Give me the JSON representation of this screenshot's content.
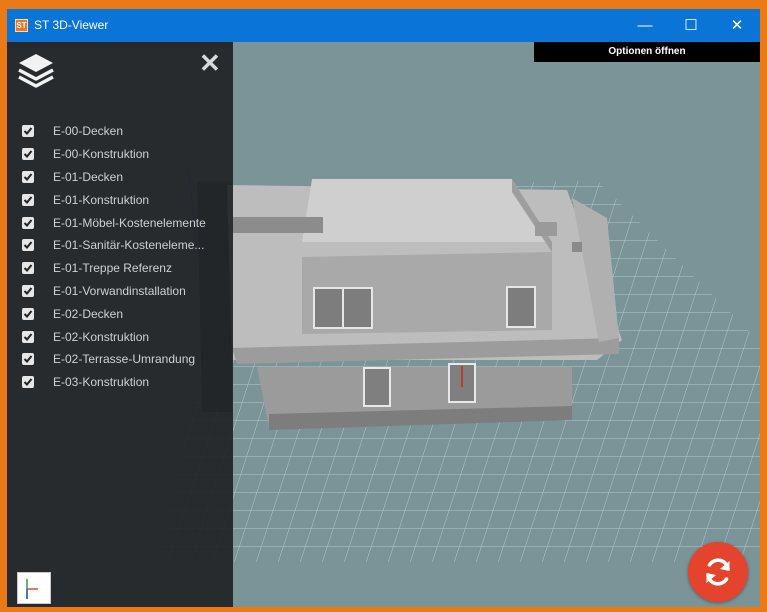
{
  "window": {
    "title": "ST 3D-Viewer",
    "app_icon_text": "ST",
    "minimize_glyph": "—",
    "maximize_glyph": "☐",
    "close_glyph": "✕"
  },
  "toolbar": {
    "options_label": "Optionen öffnen"
  },
  "layer_panel": {
    "close_glyph": "✕",
    "layers": [
      {
        "label": "E-00-Decken",
        "checked": true
      },
      {
        "label": "E-00-Konstruktion",
        "checked": true
      },
      {
        "label": "E-01-Decken",
        "checked": true
      },
      {
        "label": "E-01-Konstruktion",
        "checked": true
      },
      {
        "label": "E-01-Möbel-Kostenelemente",
        "checked": true
      },
      {
        "label": "E-01-Sanitär-Kosteneleme...",
        "checked": true
      },
      {
        "label": "E-01-Treppe Referenz",
        "checked": true
      },
      {
        "label": "E-01-Vorwandinstallation",
        "checked": true
      },
      {
        "label": "E-02-Decken",
        "checked": true
      },
      {
        "label": "E-02-Konstruktion",
        "checked": true
      },
      {
        "label": "E-02-Terrasse-Umrandung",
        "checked": true
      },
      {
        "label": "E-03-Konstruktion",
        "checked": true
      }
    ]
  },
  "colors": {
    "title_bar": "#0a75d6",
    "window_border": "#ea7a16",
    "viewport_bg": "#7a9497",
    "panel_bg": "#202426",
    "refresh_button": "#e4432e"
  },
  "icons": {
    "layers": "layers-icon",
    "axes": "axes-icon",
    "refresh": "refresh-icon"
  }
}
